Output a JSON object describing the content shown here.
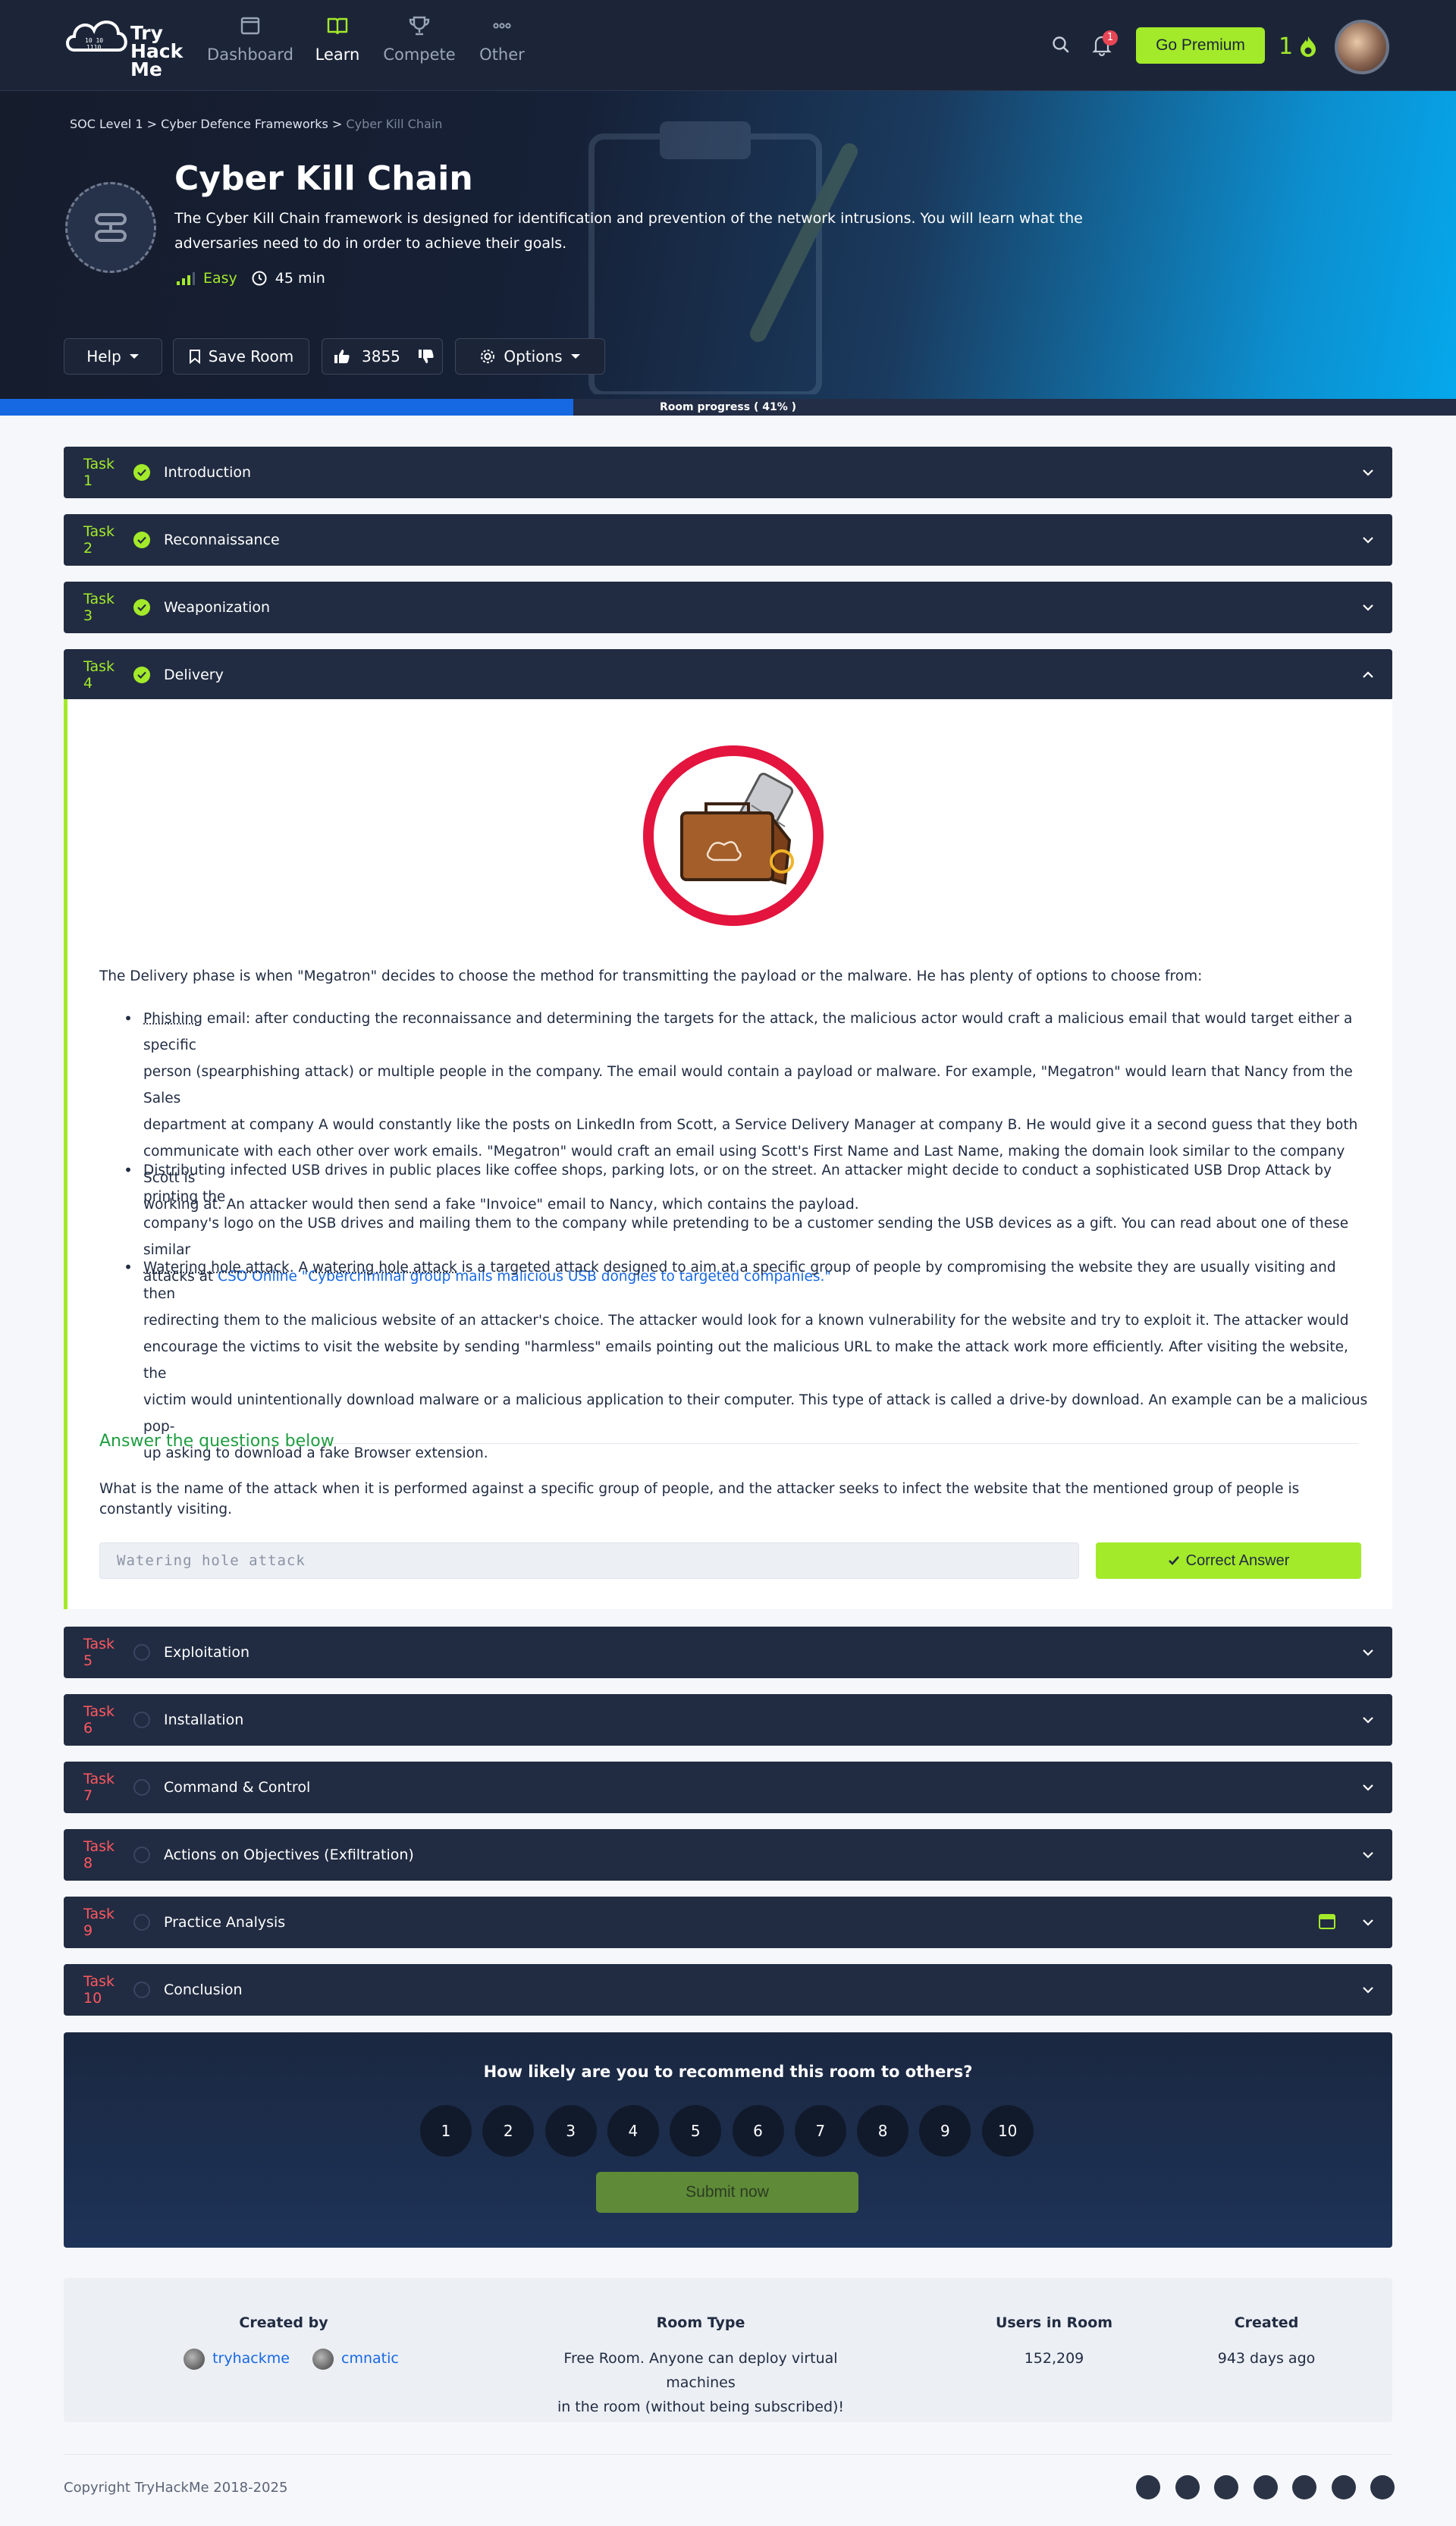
{
  "nav": {
    "logo_text": [
      "Try",
      "Hack",
      "Me"
    ],
    "items": [
      {
        "label": "Dashboard",
        "icon": "dashboard-icon",
        "active": false
      },
      {
        "label": "Learn",
        "icon": "book-icon",
        "active": true
      },
      {
        "label": "Compete",
        "icon": "trophy-icon",
        "active": false
      },
      {
        "label": "Other",
        "icon": "more-icon",
        "active": false
      }
    ],
    "notifications": "1",
    "premium_label": "Go Premium",
    "streak": "1"
  },
  "hero": {
    "breadcrumb": [
      "SOC Level 1",
      ">",
      "Cyber Defence Frameworks",
      ">",
      "Cyber Kill Chain"
    ],
    "title": "Cyber Kill Chain",
    "description": "The Cyber Kill Chain framework is designed for identification and prevention of the network intrusions. You will learn what the adversaries need to do in order to achieve their goals.",
    "difficulty": "Easy",
    "duration": "45 min",
    "help_label": "Help",
    "save_label": "Save Room",
    "likes": "3855",
    "options_label": "Options",
    "progress_label": "Room progress ( 41% )",
    "progress_percent": 41
  },
  "tasks": [
    {
      "num": "Task 1",
      "title": "Introduction",
      "done": true
    },
    {
      "num": "Task 2",
      "title": "Reconnaissance",
      "done": true
    },
    {
      "num": "Task 3",
      "title": "Weaponization",
      "done": true
    },
    {
      "num": "Task 4",
      "title": "Delivery",
      "done": true
    },
    {
      "num": "Task 5",
      "title": "Exploitation",
      "done": false
    },
    {
      "num": "Task 6",
      "title": "Installation",
      "done": false
    },
    {
      "num": "Task 7",
      "title": "Command & Control",
      "done": false
    },
    {
      "num": "Task 8",
      "title": "Actions on Objectives (Exfiltration)",
      "done": false
    },
    {
      "num": "Task 9",
      "title": "Practice Analysis",
      "done": false
    },
    {
      "num": "Task 10",
      "title": "Conclusion",
      "done": false
    }
  ],
  "task4": {
    "intro": "The Delivery phase is when \"Megatron\" decides to choose the method for transmitting the payload or the malware. He has plenty of options to choose from:",
    "b1_term": "Phishing",
    "b1_l1": "email: after conducting the reconnaissance and determining the targets for the attack, the malicious actor would craft a malicious email that would target either a specific",
    "b1_l2": "person (spearphishing attack) or multiple people in the company. The email would contain a payload or malware. For example, \"Megatron\" would learn that Nancy from the Sales",
    "b1_l3": "department at company A would constantly like the posts on LinkedIn from Scott, a Service Delivery Manager at company B. He would give it a second guess that they both",
    "b1_l4": "communicate with each other over work emails. \"Megatron\" would craft an email using Scott's First Name and Last Name, making the domain look similar to the company Scott is",
    "b1_l5": "working at. An attacker would then send a fake \"Invoice\" email to Nancy, which contains the payload.",
    "b2_l1": "Distributing infected USB drives in public places like coffee shops, parking lots, or on the street. An attacker might decide to conduct a sophisticated USB Drop Attack by printing the",
    "b2_l2": "company's logo on the USB drives and mailing them to the company while pretending to be a customer sending the USB devices as a gift. You can read about one of these similar",
    "b2_l3": "attacks at",
    "b2_link": "CSO Online \"Cybercriminal group mails malicious USB dongles to targeted companies.\"",
    "b3_term1": "Watering hole attack",
    "b3_mid": ". A",
    "b3_term2": "watering hole attack",
    "b3_l1": "is a targeted attack designed to aim at a specific group of people by compromising the website they are usually visiting and then",
    "b3_l2": "redirecting them to the malicious website of an attacker's choice. The attacker would look for a known vulnerability for the website and try to exploit it. The attacker would",
    "b3_l3": "encourage the victims to visit the website by sending \"harmless\" emails pointing out the malicious URL to make the attack work more efficiently. After visiting the website, the",
    "b3_l4": "victim would unintentionally download malware or a malicious application to their computer. This type of attack is called a drive-by download. An example can be a malicious pop-",
    "b3_l5": "up asking to download a fake Browser extension.",
    "answer_heading": "Answer the questions below",
    "question": "What is the name of the attack when it is performed against a specific group of people, and the attacker seeks to infect the website that the mentioned group of people is constantly visiting.",
    "answer": "Watering hole attack",
    "correct_label": "Correct Answer"
  },
  "feedback": {
    "question": "How likely are you to recommend this room to others?",
    "ratings": [
      "1",
      "2",
      "3",
      "4",
      "5",
      "6",
      "7",
      "8",
      "9",
      "10"
    ],
    "submit_label": "Submit now"
  },
  "info": {
    "created_by_label": "Created by",
    "creators": [
      "tryhackme",
      "cmnatic"
    ],
    "room_type_label": "Room Type",
    "room_type_l1": "Free Room. Anyone can deploy virtual machines",
    "room_type_l2": "in the room (without being subscribed)!",
    "users_label": "Users in Room",
    "users": "152,209",
    "created_label": "Created",
    "created": "943 days ago"
  },
  "footer": {
    "copyright": "Copyright TryHackMe 2018-2025",
    "social": [
      "x-icon",
      "linkedin-icon",
      "discord-icon",
      "facebook-icon",
      "youtube-icon",
      "instagram-icon",
      "pinterest-icon"
    ]
  },
  "colors": {
    "accent": "#a3ea2a",
    "nav": "#1c2538",
    "task": "#212c42",
    "progress": "#1768e3",
    "todo": "#ff575f"
  }
}
